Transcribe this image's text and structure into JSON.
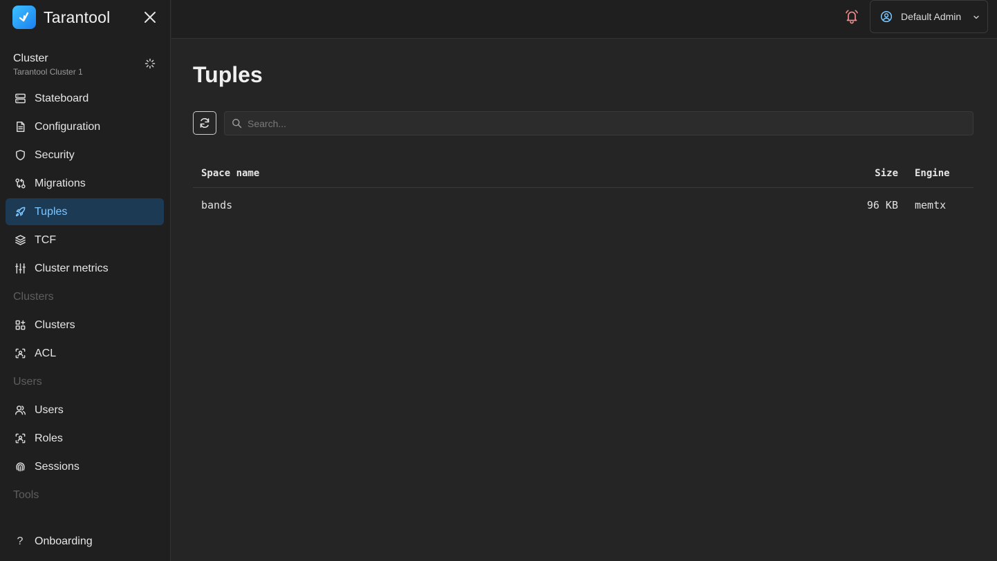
{
  "app": {
    "name": "Tarantool"
  },
  "cluster": {
    "title": "Cluster",
    "name": "Tarantool Cluster 1"
  },
  "nav": {
    "items": [
      {
        "label": "Stateboard"
      },
      {
        "label": "Configuration"
      },
      {
        "label": "Security"
      },
      {
        "label": "Migrations"
      },
      {
        "label": "Tuples"
      },
      {
        "label": "TCF"
      },
      {
        "label": "Cluster metrics"
      }
    ],
    "section_clusters": "Clusters",
    "clusters_items": [
      {
        "label": "Clusters"
      },
      {
        "label": "ACL"
      }
    ],
    "section_users": "Users",
    "users_items": [
      {
        "label": "Users"
      },
      {
        "label": "Roles"
      },
      {
        "label": "Sessions"
      }
    ],
    "section_tools": "Tools",
    "onboarding": {
      "label": "Onboarding",
      "glyph": "?"
    }
  },
  "header": {
    "user_name": "Default Admin"
  },
  "page": {
    "title": "Tuples",
    "search_placeholder": "Search..."
  },
  "table": {
    "columns": {
      "name": "Space name",
      "size": "Size",
      "engine": "Engine"
    },
    "rows": [
      {
        "name": "bands",
        "size": "96 KB",
        "engine": "memtx"
      }
    ]
  },
  "colors": {
    "accent": "#7cc7ff",
    "active_bg": "#1d3a55",
    "background": "#252525",
    "sidebar_bg": "#1f1f1f",
    "bell": "#f08a8a"
  }
}
